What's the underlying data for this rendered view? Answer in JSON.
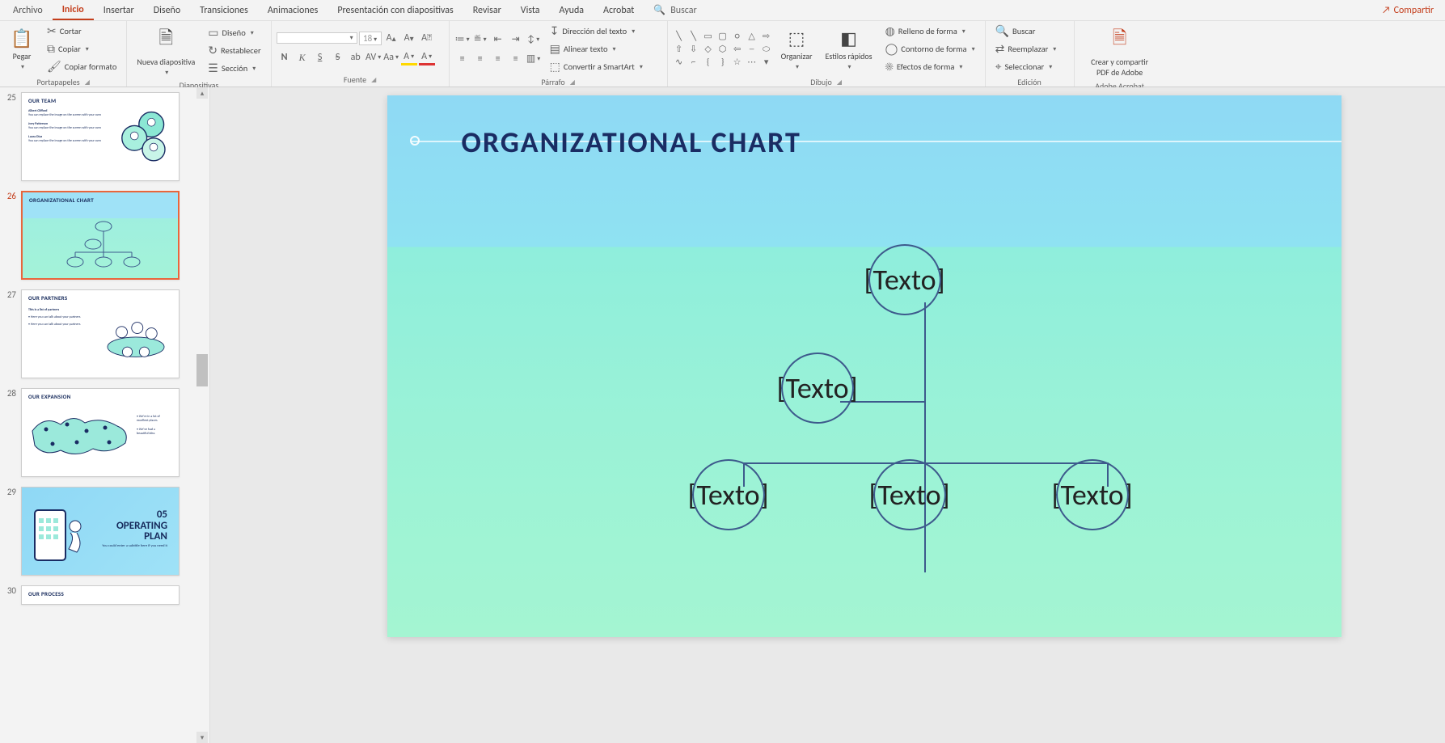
{
  "menu": {
    "archivo": "Archivo",
    "inicio": "Inicio",
    "insertar": "Insertar",
    "diseno": "Diseño",
    "transiciones": "Transiciones",
    "animaciones": "Animaciones",
    "presentacion": "Presentación con diapositivas",
    "revisar": "Revisar",
    "vista": "Vista",
    "ayuda": "Ayuda",
    "acrobat": "Acrobat",
    "buscar": "Buscar",
    "compartir": "Compartir"
  },
  "ribbon": {
    "portapapeles": {
      "label": "Portapapeles",
      "pegar": "Pegar",
      "cortar": "Cortar",
      "copiar": "Copiar",
      "copiar_formato": "Copiar formato"
    },
    "diapositivas": {
      "label": "Diapositivas",
      "nueva": "Nueva diapositiva",
      "diseno": "Diseño",
      "restablecer": "Restablecer",
      "seccion": "Sección"
    },
    "fuente": {
      "label": "Fuente",
      "size": "18"
    },
    "parrafo": {
      "label": "Párrafo",
      "direccion": "Dirección del texto",
      "alinear": "Alinear texto",
      "smartart": "Convertir a SmartArt"
    },
    "dibujo": {
      "label": "Dibujo",
      "organizar": "Organizar",
      "estilos": "Estilos rápidos",
      "relleno": "Relleno de forma",
      "contorno": "Contorno de forma",
      "efectos": "Efectos de forma"
    },
    "edicion": {
      "label": "Edición",
      "buscar": "Buscar",
      "reemplazar": "Reemplazar",
      "seleccionar": "Seleccionar"
    },
    "adobe": {
      "label": "Adobe Acrobat",
      "crear": "Crear y compartir PDF de Adobe"
    }
  },
  "thumbs": [
    {
      "num": "25",
      "title": "OUR TEAM",
      "names": [
        "Albert Clifford",
        "Joey Patterson",
        "Laura Diaz"
      ],
      "sub": "You can replace the image on the screen with your own"
    },
    {
      "num": "26",
      "title": "ORGANIZATIONAL CHART"
    },
    {
      "num": "27",
      "title": "OUR PARTNERS",
      "h": "This is a list of partners",
      "b1": "Here you can talk about your partners",
      "b2": "Here you can talk about your partners"
    },
    {
      "num": "28",
      "title": "OUR EXPANSION",
      "b1": "We're in a lot of excellent places",
      "b2": "We've had a beautiful idea"
    },
    {
      "num": "29",
      "title5n": "05",
      "title5a": "OPERATING",
      "title5b": "PLAN",
      "sub": "You could enter a subtitle here if you need it"
    },
    {
      "num": "30",
      "title": "OUR PROCESS"
    }
  ],
  "slide": {
    "title": "ORGANIZATIONAL CHART",
    "node_placeholder": "[Texto]"
  }
}
